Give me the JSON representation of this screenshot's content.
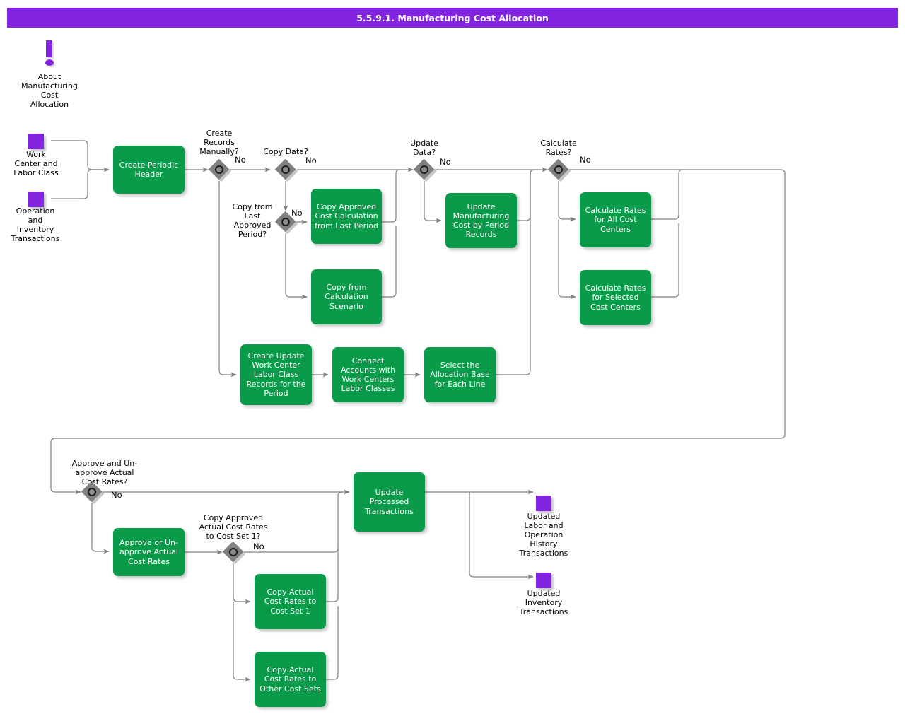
{
  "header": {
    "title": "5.5.9.1. Manufacturing Cost Allocation"
  },
  "colors": {
    "title_bar": "#8324e0",
    "activity": "#0a9b4a",
    "data_object": "#8324e0",
    "gateway": "#808080",
    "connector": "#808080",
    "activity_text": "#ffffff",
    "label_text": "#000000"
  },
  "note": {
    "icon": "exclamation-icon",
    "label": "About\nManufacturing\nCost\nAllocation"
  },
  "data_objects": [
    {
      "id": "work-center-labor-class",
      "label": "Work\nCenter and\nLabor Class"
    },
    {
      "id": "operation-inventory-transactions",
      "label": "Operation\nand\nInventory\nTransactions"
    },
    {
      "id": "updated-labor-operation-history",
      "label": "Updated\nLabor and\nOperation\nHistory\nTransactions"
    },
    {
      "id": "updated-inventory-transactions",
      "label": "Updated\nInventory\nTransactions"
    }
  ],
  "gateways": [
    {
      "id": "create-records-manually",
      "label": "Create\nRecords\nManually?",
      "branch": "No"
    },
    {
      "id": "copy-data",
      "label": "Copy Data?",
      "branch": "No"
    },
    {
      "id": "copy-from-last-approved-period",
      "label": "Copy from\nLast\nApproved\nPeriod?",
      "branch": "No"
    },
    {
      "id": "update-data",
      "label": "Update\nData?",
      "branch": "No"
    },
    {
      "id": "calculate-rates",
      "label": "Calculate\nRates?",
      "branch": "No"
    },
    {
      "id": "approve-unapprove-actual-cost-rates",
      "label": "Approve and Un-\napprove Actual\nCost Rates?",
      "branch": "No"
    },
    {
      "id": "copy-approved-actual-cost-rates-to-cost-set-1",
      "label": "Copy Approved\nActual Cost Rates\nto Cost Set 1?",
      "branch": "No"
    }
  ],
  "activities": [
    {
      "id": "create-periodic-header",
      "label": "Create Periodic\nHeader"
    },
    {
      "id": "copy-approved-cost-calculation-from-last-period",
      "label": "Copy Approved\nCost Calculation\nfrom Last Period"
    },
    {
      "id": "copy-from-calculation-scenario",
      "label": "Copy from\nCalculation\nScenario"
    },
    {
      "id": "update-manufacturing-cost-by-period-records",
      "label": "Update\nManufacturing\nCost by Period\nRecords"
    },
    {
      "id": "calculate-rates-for-all-cost-centers",
      "label": "Calculate Rates\nfor All Cost\nCenters"
    },
    {
      "id": "calculate-rates-for-selected-cost-centers",
      "label": "Calculate Rates\nfor Selected\nCost Centers"
    },
    {
      "id": "create-update-work-center-labor-class-records",
      "label": "Create Update\nWork Center\nLabor Class\nRecords for the\nPeriod"
    },
    {
      "id": "connect-accounts-with-work-centers-labor-classes",
      "label": "Connect\nAccounts with\nWork Centers\nLabor Classes"
    },
    {
      "id": "select-the-allocation-base-for-each-line",
      "label": "Select the\nAllocation Base\nfor Each Line"
    },
    {
      "id": "approve-or-unapprove-actual-cost-rates",
      "label": "Approve or Un-\napprove Actual\nCost Rates"
    },
    {
      "id": "update-processed-transactions",
      "label": "Update\nProcessed\nTransactions"
    },
    {
      "id": "copy-actual-cost-rates-to-cost-set-1",
      "label": "Copy Actual\nCost Rates to\nCost Set 1"
    },
    {
      "id": "copy-actual-cost-rates-to-other-cost-sets",
      "label": "Copy Actual\nCost Rates to\nOther Cost Sets"
    }
  ]
}
